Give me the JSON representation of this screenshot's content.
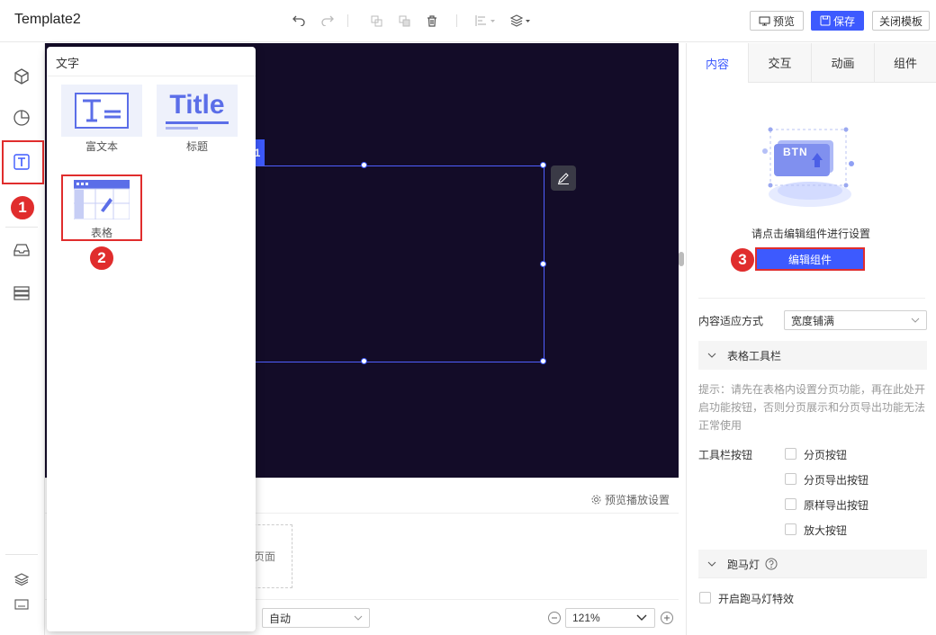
{
  "app": {
    "title": "Template2"
  },
  "header": {
    "preview_label": "预览",
    "save_label": "保存",
    "close_label": "关闭模板"
  },
  "left_panel": {
    "title": "文字",
    "components": [
      {
        "label": "富文本",
        "icon": "rich-text-icon"
      },
      {
        "label": "标题",
        "icon": "title-icon",
        "thumb_text": "Title"
      },
      {
        "label": "表格",
        "icon": "table-icon"
      }
    ]
  },
  "canvas": {
    "selection_tag": "1"
  },
  "bottom": {
    "preview_settings_label": "预览播放设置",
    "page_placeholder": "页面",
    "fit_mode": "自动",
    "zoom": "121%"
  },
  "right_panel": {
    "tabs": [
      "内容",
      "交互",
      "动画",
      "组件"
    ],
    "illustration_text": "BTN",
    "hint": "请点击编辑组件进行设置",
    "edit_button": "编辑组件",
    "fit_label": "内容适应方式",
    "fit_value": "宽度铺满",
    "toolbar_section": "表格工具栏",
    "toolbar_tip": "提示：请先在表格内设置分页功能，再在此处开启功能按钮，否则分页展示和分页导出功能无法正常使用",
    "toolbar_buttons_label": "工具栏按钮",
    "toolbar_options": [
      "分页按钮",
      "分页导出按钮",
      "原样导出按钮",
      "放大按钮"
    ],
    "marquee_section": "跑马灯",
    "marquee_option": "开启跑马灯特效"
  },
  "annotations": [
    "1",
    "2",
    "3"
  ],
  "colors": {
    "accent": "#3d5afe",
    "canvas_bg": "#130c28",
    "annotation_red": "#e02d2d"
  }
}
